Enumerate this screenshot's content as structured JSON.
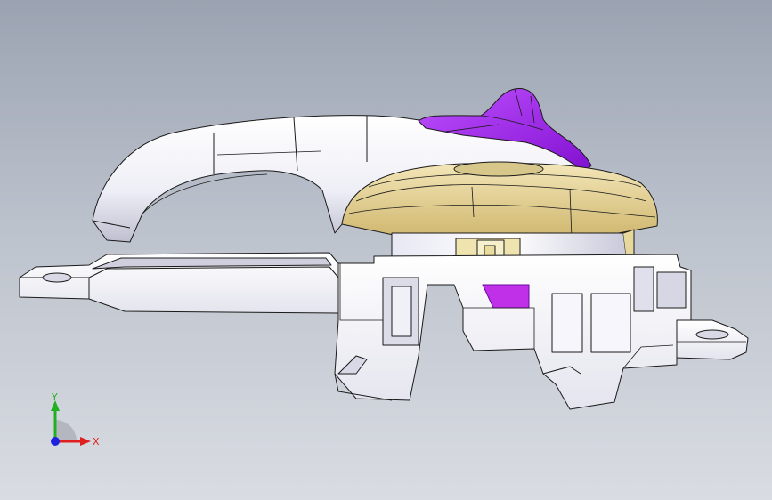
{
  "viewport": {
    "background_top": "#9ba3b2",
    "background_bottom": "#d9dce2"
  },
  "model": {
    "colors": {
      "body": "#f4f4fa",
      "body_shade": "#c9c9d8",
      "edge": "#1a1a1a",
      "rosette": "#e9d79a",
      "rosette_shade": "#cdb86c",
      "highlight": "#a020f0",
      "highlight_dark": "#7a10c0"
    }
  },
  "triad": {
    "x_label": "X",
    "y_label": "Y",
    "x_color": "#e02020",
    "y_color": "#20b020",
    "z_color": "#2020e0",
    "icon": "coordinate-triad-icon"
  }
}
